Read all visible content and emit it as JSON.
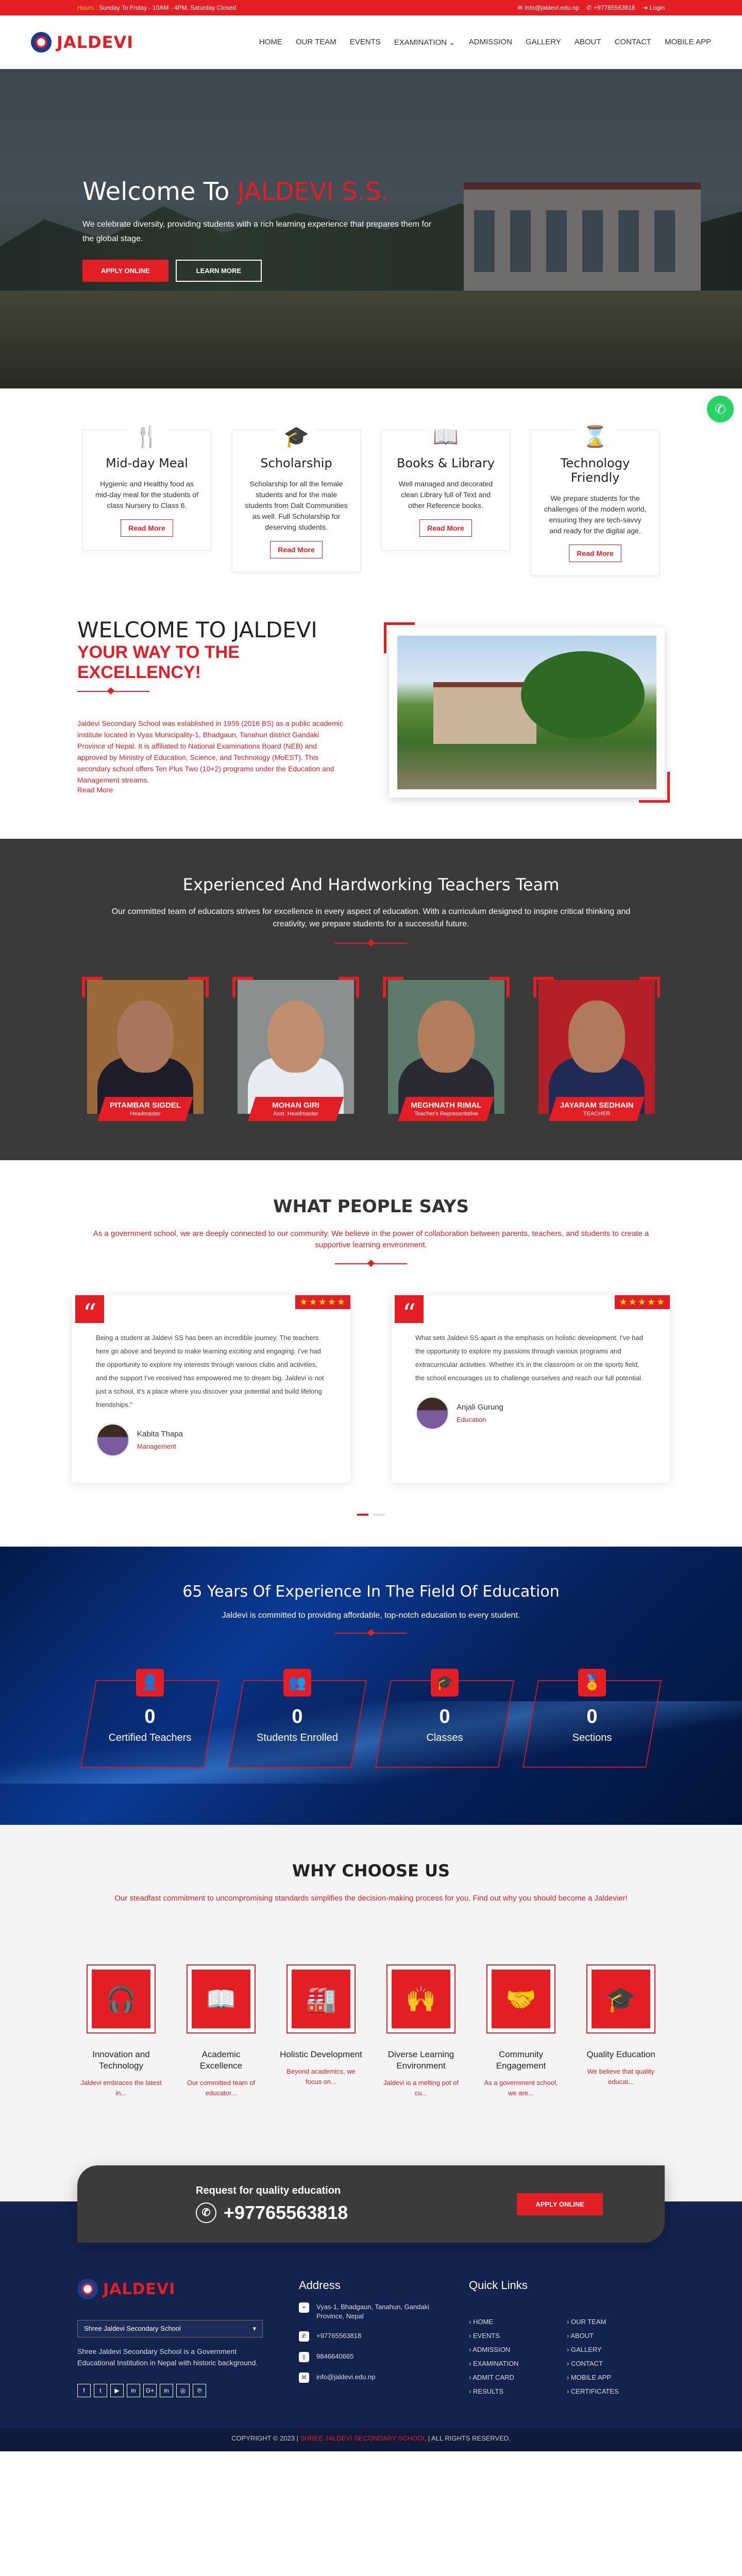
{
  "topbar": {
    "hours_label": "Hours :",
    "hours_value": "Sunday To Friday - 10AM - 4PM, Saturday Closed",
    "email": "info@jaldevi.edu.np",
    "phone": "+97765563818",
    "login": "Login"
  },
  "header": {
    "logo_text": "JALDEVI",
    "nav": [
      "HOME",
      "OUR TEAM",
      "EVENTS",
      "EXAMINATION",
      "ADMISSION",
      "GALLERY",
      "ABOUT",
      "CONTACT",
      "MOBILE APP"
    ]
  },
  "hero": {
    "title_prefix": "Welcome To ",
    "title_highlight": "JALDEVI S.S.",
    "text": "We celebrate diversity, providing students with a rich learning experience that prepares them for the global stage.",
    "apply_label": "APPLY ONLINE",
    "learn_label": "LEARN MORE"
  },
  "features": [
    {
      "icon": "🍴",
      "icon_name": "fork-knife-icon",
      "title": "Mid-day Meal",
      "text": "Hygienic and Healthy food as mid-day meal for the students of class Nursery to Class 6.",
      "button": "Read More"
    },
    {
      "icon": "🎓",
      "icon_name": "graduation-cap-icon",
      "title": "Scholarship",
      "text": "Scholarship for all the female students and for the male students from Dalt Communities as well. Full Scholarship for deserving students.",
      "button": "Read More"
    },
    {
      "icon": "📖",
      "icon_name": "book-icon",
      "title": "Books & Library",
      "text": "Well managed and decorated clean Library full of Text and other Reference books.",
      "button": "Read More"
    },
    {
      "icon": "⌛",
      "icon_name": "hourglass-icon",
      "title": "Technology Friendly",
      "text": "We prepare students for the challenges of the modern world, ensuring they are tech-savvy and ready for the digital age.",
      "button": "Read More"
    }
  ],
  "welcome": {
    "title": "WELCOME TO JALDEVI",
    "subtitle": "YOUR WAY TO THE EXCELLENCY!",
    "text": "Jaldevi Secondary School was established in 1959 (2016 BS) as a public academic institute located in Vyas Municipality-1, Bhadgaun, Tanahun district Gandaki Province of Nepal. It is affiliated to National Examinations Board (NEB) and approved by Ministry of Education, Science, and Technology (MoEST). This secondary school offers Ten Plus Two (10+2) programs under the Education and Management streams.",
    "more": "Read More"
  },
  "team": {
    "title": "Experienced And Hardworking Teachers Team",
    "text": "Our committed team of educators strives for excellence in every aspect of education. With a curriculum designed to inspire critical thinking and creativity, we prepare students for a successful future.",
    "members": [
      {
        "name": "PITAMBAR SIGDEL",
        "role": "Headmaster",
        "skin": "#a8765a",
        "cloth": "#1d1d2a",
        "bg": "#9a6a3a"
      },
      {
        "name": "MOHAN GIRI",
        "role": "Asst. Headmaster",
        "skin": "#c08f70",
        "cloth": "#e8ebf2",
        "bg": "#8a8f90"
      },
      {
        "name": "MEGHNATH RIMAL",
        "role": "Teacher's Representative",
        "skin": "#b27e5e",
        "cloth": "#2a2a35",
        "bg": "#5e7a6a"
      },
      {
        "name": "JAYARAM SEDHAIN",
        "role": "TEACHER",
        "skin": "#b07b5c",
        "cloth": "#1f2b55",
        "bg": "#b52028"
      }
    ]
  },
  "testimonials": {
    "title": "WHAT PEOPLE SAYS",
    "text": "As a government school, we are deeply connected to our community. We believe in the power of collaboration between parents, teachers, and students to create a supportive learning environment.",
    "stars": "★★★★★",
    "quote_mark": "“",
    "items": [
      {
        "text": "Being a student at Jaldevi SS has been an incredible journey. The teachers here go above and beyond to make learning exciting and engaging. I've had the opportunity to explore my interests through various clubs and activities, and the support I've received has empowered me to dream big. Jaldevi is not just a school, it's a place where you discover your potential and build lifelong friendships.\"",
        "name": "Kabita Thapa",
        "role": "Management"
      },
      {
        "text": "What sets Jaldevi SS apart is the emphasis on holistic development. I've had the opportunity to explore my passions through various programs and extracurricular activities. Whether it's in the classroom or on the sports field, the school encourages us to challenge ourselves and reach our full potential.",
        "name": "Anjali Gurung",
        "role": "Education"
      }
    ]
  },
  "stats": {
    "title": "65 Years Of Experience In The Field Of Education",
    "text": "Jaldevi is committed to providing affordable, top-notch education to every student.",
    "items": [
      {
        "icon": "👤",
        "icon_name": "teacher-icon",
        "value": "0",
        "label": "Certified Teachers"
      },
      {
        "icon": "👥",
        "icon_name": "students-icon",
        "value": "0",
        "label": "Students Enrolled"
      },
      {
        "icon": "🎓",
        "icon_name": "graduation-cap-icon",
        "value": "0",
        "label": "Classes"
      },
      {
        "icon": "🏅",
        "icon_name": "medal-icon",
        "value": "0",
        "label": "Sections"
      }
    ]
  },
  "why": {
    "title": "WHY CHOOSE US",
    "text": "Our steadfast commitment to uncompromising standards simplifies the decision-making process for you. Find out why you should become a Jaldevier!",
    "items": [
      {
        "icon": "🎧",
        "icon_name": "headphones-icon",
        "title": "Innovation and Technology",
        "text": "Jaldevi embraces the latest in..."
      },
      {
        "icon": "📖",
        "icon_name": "open-book-icon",
        "title": "Academic Excellence",
        "text": "Our committed team of educator..."
      },
      {
        "icon": "🏭",
        "icon_name": "factory-icon",
        "title": "Holistic Development",
        "text": "Beyond academics, we focus on..."
      },
      {
        "icon": "🙌",
        "icon_name": "person-raise-icon",
        "title": "Diverse Learning Environment",
        "text": "Jaldevi is a melting pot of cu..."
      },
      {
        "icon": "🤝",
        "icon_name": "community-icon",
        "title": "Community Engagement",
        "text": "As a government school, we are..."
      },
      {
        "icon": "🎓",
        "icon_name": "graduate-icon",
        "title": "Quality Education",
        "text": "We believe that quality educat..."
      }
    ]
  },
  "cta": {
    "title": "Request for quality education",
    "phone": "+97765563818",
    "button": "APPLY ONLINE"
  },
  "footer": {
    "logo_text": "JALDEVI",
    "select_value": "Shree Jaldevi Secondary School",
    "about": "Shree Jaldevi Secondary School is a Government Educational Institution in Nepal with historic background.",
    "social": [
      "f",
      "t",
      "▶",
      "in",
      "G+",
      "in",
      "◎",
      "℗"
    ],
    "address_title": "Address",
    "address": "Vyas-1, Bhadgaun, Tanahun, Gandaki Province, Nepal",
    "phone1": "+97765563818",
    "phone2": "9846640665",
    "email": "info@jaldevi.edu.np",
    "links_title": "Quick Links",
    "links": [
      "HOME",
      "OUR TEAM",
      "EVENTS",
      "ABOUT",
      "ADMISSION",
      "GALLERY",
      "EXAMINATION",
      "CONTACT",
      "ADMIT CARD",
      "MOBILE APP",
      "RESULTS",
      "CERTIFICATES"
    ]
  },
  "bottom": {
    "prefix": "COPYRIGHT © 2023 | ",
    "school": "SHREE JALDEVI SECONDARY SCHOOL",
    "suffix": " | ALL RIGHTS RESERVED."
  },
  "colors": {
    "brand_red": "#e31e24",
    "navy": "#14224e",
    "dark_gray": "#3a3a3a"
  }
}
